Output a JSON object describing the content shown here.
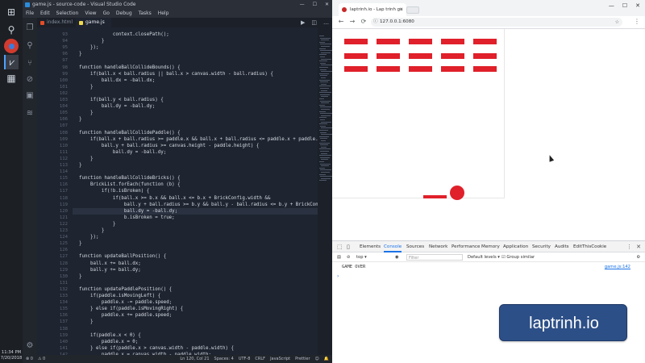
{
  "taskbar": {
    "time": "11:34 PM",
    "date": "7/20/2018",
    "icons": [
      "start-icon",
      "search-icon",
      "chrome-icon",
      "vscode-icon",
      "store-icon"
    ]
  },
  "vscode": {
    "title": "game.js - source-code - Visual Studio Code",
    "window_buttons": [
      "—",
      "☐",
      "✕"
    ],
    "menu": [
      "File",
      "Edit",
      "Selection",
      "View",
      "Go",
      "Debug",
      "Tasks",
      "Help"
    ],
    "tabs": [
      {
        "label": "index.html",
        "color": "#e44d26"
      },
      {
        "label": "game.js",
        "color": "#f0db4f"
      }
    ],
    "tab_tools": [
      "▶",
      "◫",
      "…"
    ],
    "code_lines": [
      {
        "n": "93",
        "text": "            context.closePath();"
      },
      {
        "n": "94",
        "text": "        }"
      },
      {
        "n": "95",
        "text": "    });"
      },
      {
        "n": "96",
        "text": "}"
      },
      {
        "n": "97",
        "text": ""
      },
      {
        "n": "98",
        "text": "function handleBallCollideBounds() {"
      },
      {
        "n": "99",
        "text": "    if(ball.x < ball.radius || ball.x > canvas.width - ball.radius) {"
      },
      {
        "n": "100",
        "text": "        ball.dx = -ball.dx;"
      },
      {
        "n": "101",
        "text": "    }"
      },
      {
        "n": "102",
        "text": ""
      },
      {
        "n": "103",
        "text": "    if(ball.y < ball.radius) {"
      },
      {
        "n": "104",
        "text": "        ball.dy = -ball.dy;"
      },
      {
        "n": "105",
        "text": "    }"
      },
      {
        "n": "106",
        "text": "}"
      },
      {
        "n": "107",
        "text": ""
      },
      {
        "n": "108",
        "text": "function handleBallCollidePaddle() {"
      },
      {
        "n": "109",
        "text": "    if(ball.x + ball.radius >= paddle.x && ball.x + ball.radius <= paddle.x + paddle.width &&"
      },
      {
        "n": "110",
        "text": "        ball.y + ball.radius >= canvas.height - paddle.height) {"
      },
      {
        "n": "111",
        "text": "            ball.dy = -ball.dy;"
      },
      {
        "n": "112",
        "text": "    }"
      },
      {
        "n": "113",
        "text": "}"
      },
      {
        "n": "114",
        "text": ""
      },
      {
        "n": "115",
        "text": "function handleBallCollideBricks() {"
      },
      {
        "n": "116",
        "text": "    BrickList.forEach(function (b) {"
      },
      {
        "n": "117",
        "text": "        if(!b.isBroken) {"
      },
      {
        "n": "118",
        "text": "            if(ball.x >= b.x && ball.x <= b.x + BrickConfig.width &&"
      },
      {
        "n": "119",
        "text": "                ball.y + ball.radius >= b.y && ball.y - ball.radius <= b.y + BrickConfig.height) {"
      },
      {
        "n": "120",
        "text": "                ball.dy = -ball.dy;"
      },
      {
        "n": "121",
        "text": "                b.isBroken = true;"
      },
      {
        "n": "122",
        "text": "            }"
      },
      {
        "n": "123",
        "text": "        }"
      },
      {
        "n": "124",
        "text": "    });"
      },
      {
        "n": "125",
        "text": "}"
      },
      {
        "n": "126",
        "text": ""
      },
      {
        "n": "127",
        "text": "function updateBallPosition() {"
      },
      {
        "n": "128",
        "text": "    ball.x += ball.dx;"
      },
      {
        "n": "129",
        "text": "    ball.y += ball.dy;"
      },
      {
        "n": "130",
        "text": "}"
      },
      {
        "n": "131",
        "text": ""
      },
      {
        "n": "132",
        "text": "function updatePaddlePosition() {"
      },
      {
        "n": "133",
        "text": "    if(paddle.isMovingLeft) {"
      },
      {
        "n": "134",
        "text": "        paddle.x -= paddle.speed;"
      },
      {
        "n": "135",
        "text": "    } else if(paddle.isMovingRight) {"
      },
      {
        "n": "136",
        "text": "        paddle.x += paddle.speed;"
      },
      {
        "n": "137",
        "text": "    }"
      },
      {
        "n": "138",
        "text": ""
      },
      {
        "n": "139",
        "text": "    if(paddle.x < 0) {"
      },
      {
        "n": "140",
        "text": "        paddle.x = 0;"
      },
      {
        "n": "141",
        "text": "    } else if(paddle.x > canvas.width - paddle.width) {"
      },
      {
        "n": "142",
        "text": "        paddle.x = canvas.width - paddle.width;"
      },
      {
        "n": "143",
        "text": "    }"
      }
    ],
    "status": {
      "errors": "⊗ 0",
      "warnings": "⚠ 0",
      "position": "Ln 120, Col 21",
      "spaces": "Spaces: 4",
      "encoding": "UTF-8",
      "eol": "CRLF",
      "language": "JavaScript",
      "formatter": "Prettier"
    }
  },
  "chrome": {
    "tab_title": "laptrinh.io - Lap trinh gu",
    "window_buttons": [
      "—",
      "☐",
      "✕"
    ],
    "nav": {
      "back": "←",
      "forward": "→",
      "reload": "⟳"
    },
    "url": "127.0.0.1:6080",
    "devtools": {
      "tabs": [
        "Elements",
        "Console",
        "Sources",
        "Network",
        "Performance",
        "Memory",
        "Application",
        "Security",
        "Audits",
        "EditThisCookie"
      ],
      "active_tab": "Console",
      "context": "top",
      "filter_placeholder": "Filter",
      "levels": "Default levels ▾",
      "group_similar": "Group similar",
      "message": "GAME OVER",
      "message_source": "game.js:142",
      "prompt": "›"
    }
  },
  "badge": {
    "text": "laptrinh.io"
  },
  "colors": {
    "brick": "#e0202a",
    "badge": "#2d4f87",
    "accent": "#1a73e8"
  }
}
